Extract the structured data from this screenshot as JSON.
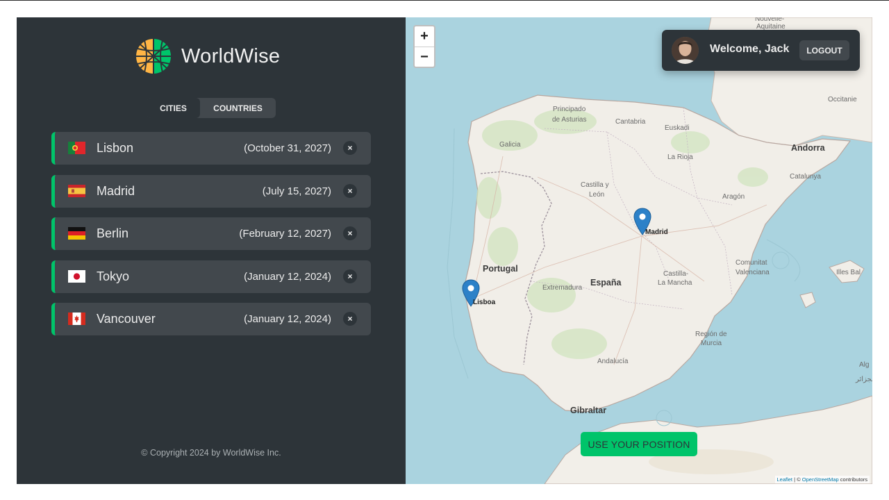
{
  "app": {
    "name": "WorldWise"
  },
  "tabs": [
    {
      "label": "CITIES"
    },
    {
      "label": "COUNTRIES"
    }
  ],
  "cities": [
    {
      "name": "Lisbon",
      "date": "(October 31, 2027)",
      "flag": "portugal-flag"
    },
    {
      "name": "Madrid",
      "date": "(July 15, 2027)",
      "flag": "spain-flag"
    },
    {
      "name": "Berlin",
      "date": "(February 12, 2027)",
      "flag": "germany-flag"
    },
    {
      "name": "Tokyo",
      "date": "(January 12, 2024)",
      "flag": "japan-flag"
    },
    {
      "name": "Vancouver",
      "date": "(January 12, 2024)",
      "flag": "canada-flag"
    }
  ],
  "delete_label": "×",
  "copyright": "© Copyright 2024 by WorldWise Inc.",
  "user": {
    "welcome": "Welcome, Jack",
    "logout_label": "LOGOUT"
  },
  "map": {
    "zoom_in": "+",
    "zoom_out": "−",
    "position_button": "USE YOUR POSITION",
    "attribution": {
      "leaflet": "Leaflet",
      "sep": " | © ",
      "osm": "OpenStreetMap",
      "tail": " contributors"
    },
    "countries": {
      "portugal": "Portugal",
      "spain": "España",
      "andorra": "Andorra",
      "gibraltar": "Gibraltar"
    },
    "regions": {
      "galicia": "Galicia",
      "asturias1": "Principado",
      "asturias2": "de Asturias",
      "cantabria": "Cantabria",
      "euskadi": "Euskadi",
      "rioja": "La Rioja",
      "catalunya": "Catalunya",
      "aragon": "Aragón",
      "castilla_leon1": "Castilla y",
      "castilla_leon2": "León",
      "extremadura": "Extremadura",
      "castilla_mancha1": "Castilla-",
      "castilla_mancha2": "La Mancha",
      "valenciana1": "Comunitat",
      "valenciana2": "Valenciana",
      "murcia1": "Región de",
      "murcia2": "Murcia",
      "andalucia": "Andalucía",
      "occitanie": "Occitanie",
      "nouvelle1": "Nouvelle-",
      "nouvelle2": "Aquitaine",
      "illes": "Illes Bal",
      "algeria1": "Alg",
      "algeria2": "الجزائر"
    },
    "markers": [
      {
        "label": "Madrid"
      },
      {
        "label": "Lisboa"
      }
    ]
  },
  "colors": {
    "accent": "#00c46a",
    "panel": "#2d3439",
    "card": "#42484d",
    "sea": "#aad3df",
    "land": "#f1eee8"
  }
}
